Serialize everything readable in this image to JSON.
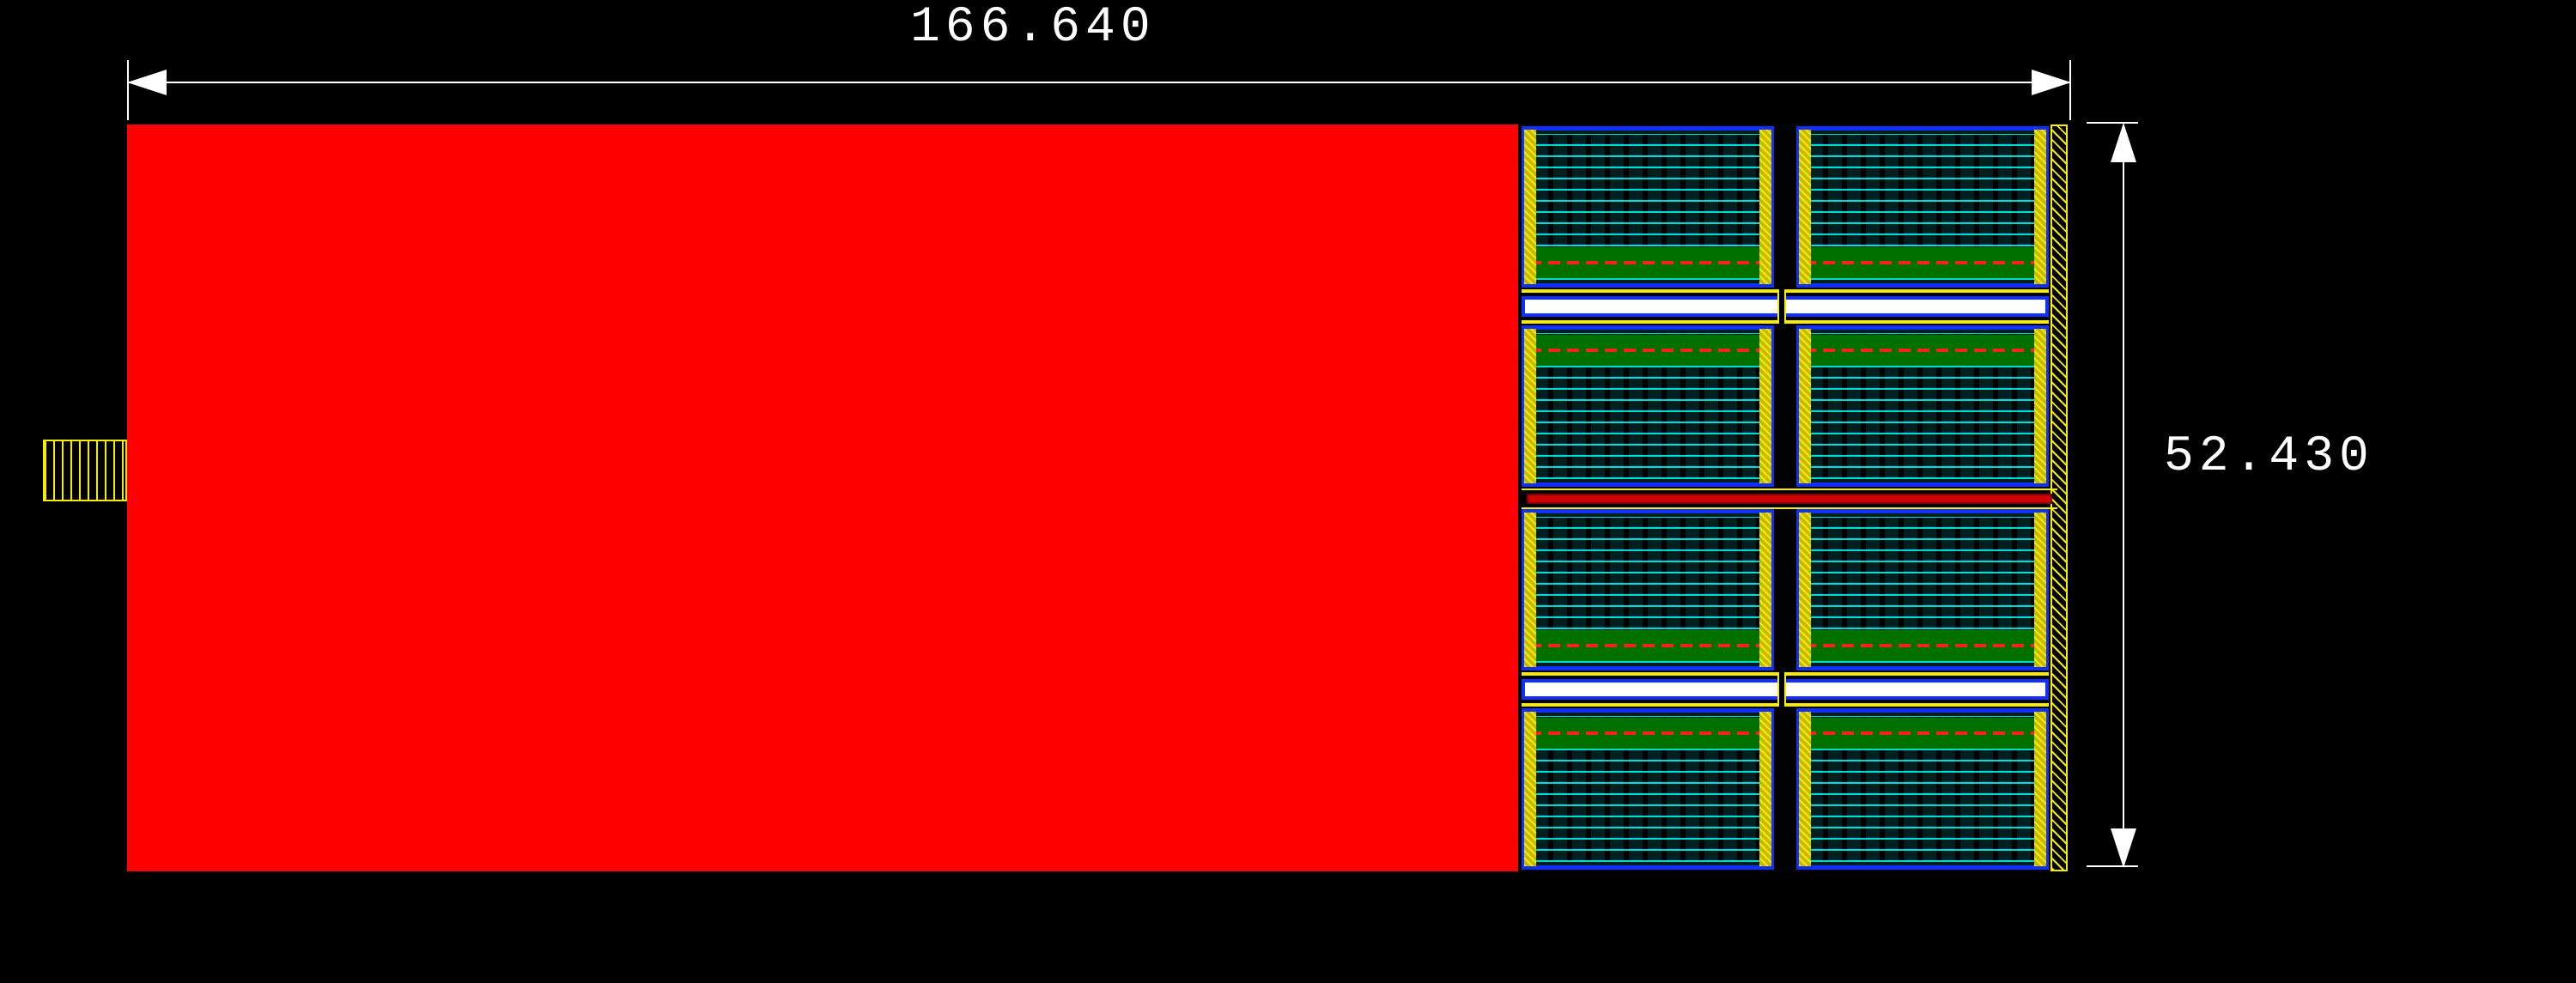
{
  "dimensions": {
    "width_um": "166.640",
    "height_um": "52.430"
  },
  "colors": {
    "metal_red": "#ff0000",
    "poly_yellow": "#f5ed00",
    "diff_blue": "#1030ff",
    "active_cyan": "#00dccb",
    "nwell_green": "#007000",
    "contact_red": "#ff2020",
    "background": "#000000",
    "dim_line": "#ffffff"
  },
  "layout": {
    "red_block": {
      "left_um": 0,
      "width_frac": 0.72
    },
    "array_cols": 2,
    "array_halves": 2,
    "rows_per_half": 2,
    "left_pad_present": true
  }
}
